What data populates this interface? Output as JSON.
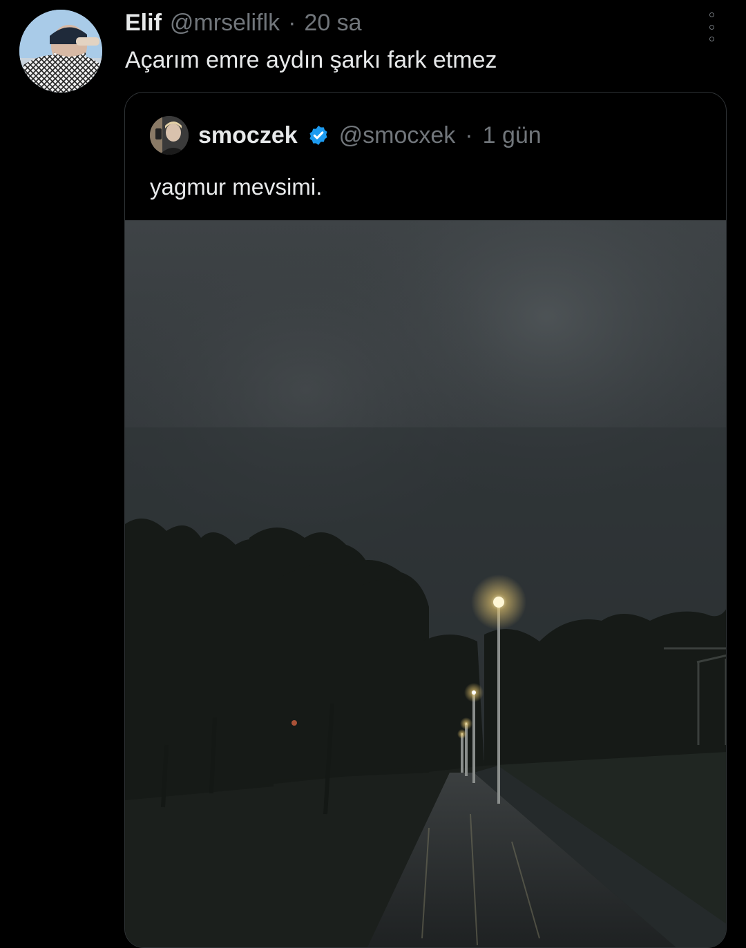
{
  "tweet": {
    "author_name": "Elif",
    "author_handle": "@mrseliflk",
    "separator": "·",
    "time": "20 sa",
    "text": "Açarım emre aydın şarkı fark etmez",
    "more_icon": "more-vertical-icon"
  },
  "quoted_tweet": {
    "author_name": "smoczek",
    "verified_icon": "verified-badge-icon",
    "author_handle": "@smocxek",
    "separator": "·",
    "time": "1 gün",
    "text": "yagmur mevsimi."
  },
  "colors": {
    "background": "#000000",
    "text_primary": "#e7e9ea",
    "text_secondary": "#71767b",
    "verified_blue": "#1d9bf0",
    "border": "#2f3336"
  }
}
